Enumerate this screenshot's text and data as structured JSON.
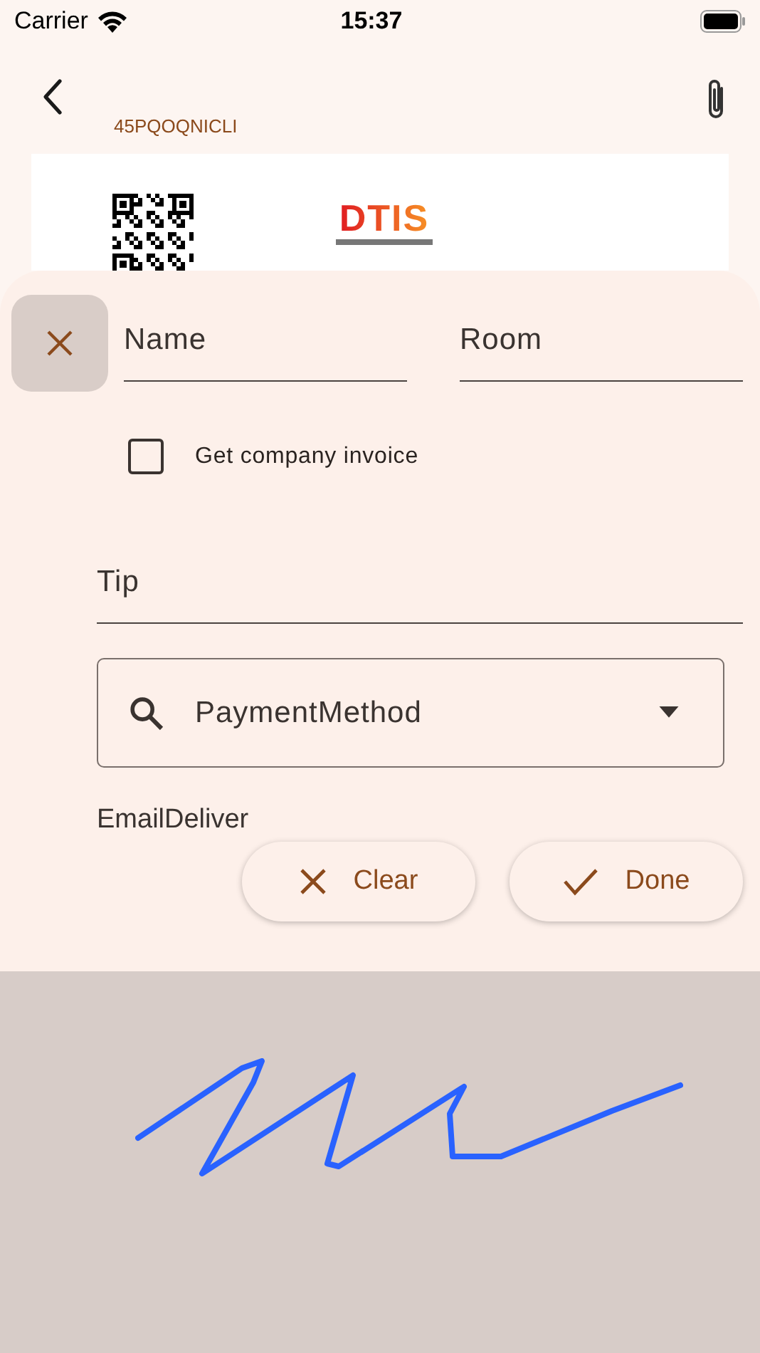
{
  "status_bar": {
    "carrier": "Carrier",
    "time": "15:37"
  },
  "header": {
    "code": "45PQOQNICLI"
  },
  "receipt": {
    "logo": "DTIS"
  },
  "form": {
    "name": {
      "placeholder": "Name"
    },
    "room": {
      "placeholder": "Room"
    },
    "company_invoice": {
      "label": "Get company invoice",
      "checked": false
    },
    "tip": {
      "placeholder": "Tip"
    },
    "payment_method": {
      "placeholder": "PaymentMethod"
    },
    "email_label": "EmailDeliver"
  },
  "buttons": [
    {
      "kind": "clear",
      "label": "Clear"
    },
    {
      "kind": "done",
      "label": "Done"
    }
  ]
}
